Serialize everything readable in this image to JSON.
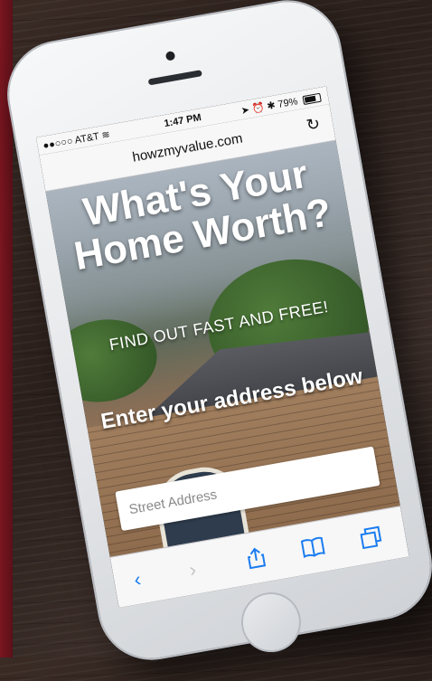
{
  "status_bar": {
    "carrier": "●●○○○ AT&T",
    "wifi_icon": "wifi-icon",
    "time": "1:47 PM",
    "indicators": "➤ ⏰ ✱",
    "battery": "79%"
  },
  "browser": {
    "url": "howzmyvalue.com",
    "reload_icon": "reload-icon"
  },
  "page": {
    "headline": "What's Your Home Worth?",
    "subheadline": "FIND OUT FAST AND FREE!",
    "cta": "Enter your address below",
    "address_placeholder": "Street Address"
  },
  "toolbar": {
    "back_icon": "chevron-left-icon",
    "forward_icon": "chevron-right-icon",
    "share_icon": "share-icon",
    "bookmarks_icon": "book-icon",
    "tabs_icon": "tabs-icon",
    "accent": "#1a7cf0"
  }
}
